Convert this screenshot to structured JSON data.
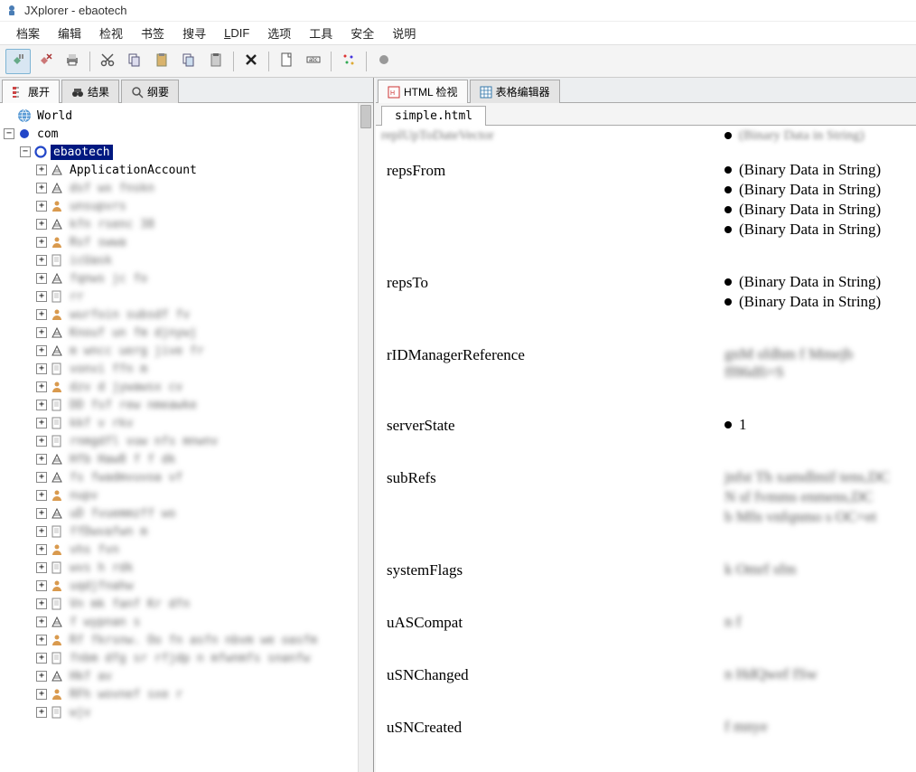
{
  "window": {
    "title": "JXplorer - ebaotech"
  },
  "menu": {
    "items": [
      {
        "label": "档案",
        "key": "file"
      },
      {
        "label": "编辑",
        "key": "edit"
      },
      {
        "label": "检视",
        "key": "view"
      },
      {
        "label": "书签",
        "key": "bookmark"
      },
      {
        "label": "搜寻",
        "key": "search"
      },
      {
        "label": "LDIF",
        "key": "ldif",
        "underlineFirst": true
      },
      {
        "label": "选项",
        "key": "options"
      },
      {
        "label": "工具",
        "key": "tools"
      },
      {
        "label": "安全",
        "key": "security"
      },
      {
        "label": "说明",
        "key": "help"
      }
    ]
  },
  "toolbar": {
    "groups": [
      [
        {
          "name": "connect",
          "icon": "plug"
        },
        {
          "name": "disconnect",
          "icon": "plug-x"
        },
        {
          "name": "print",
          "icon": "printer"
        }
      ],
      [
        {
          "name": "cut",
          "icon": "scissors"
        },
        {
          "name": "copy",
          "icon": "copy"
        },
        {
          "name": "paste",
          "icon": "paste"
        },
        {
          "name": "copy-alt",
          "icon": "copy2"
        },
        {
          "name": "paste-alt",
          "icon": "paste2"
        }
      ],
      [
        {
          "name": "delete",
          "icon": "x"
        }
      ],
      [
        {
          "name": "new",
          "icon": "page"
        },
        {
          "name": "rename",
          "icon": "field"
        }
      ],
      [
        {
          "name": "refresh",
          "icon": "sparkle"
        }
      ],
      [
        {
          "name": "stop",
          "icon": "stop-dot"
        }
      ]
    ]
  },
  "leftPane": {
    "tabs": [
      {
        "label": "展开",
        "icon": "tree",
        "active": true
      },
      {
        "label": "结果",
        "icon": "binoculars",
        "active": false
      },
      {
        "label": "纲要",
        "icon": "magnifier",
        "active": false
      }
    ],
    "tree": {
      "root": "World",
      "com": "com",
      "selected": "ebaotech",
      "children": [
        {
          "label": "ApplicationAccount",
          "clear": true
        },
        {
          "label": "dsf wx fnskn",
          "clear": false
        },
        {
          "label": "unsupvrs",
          "clear": false
        },
        {
          "label": "kfn rsenc 38",
          "clear": false
        },
        {
          "label": "Rsf swwa",
          "clear": false
        },
        {
          "label": "icUask",
          "clear": false
        },
        {
          "label": "fqnws jc fo",
          "clear": false
        },
        {
          "label": "rr",
          "clear": false
        },
        {
          "label": "wurfoin subsdf fv",
          "clear": false
        },
        {
          "label": "Knouf un fm djnywj",
          "clear": false
        },
        {
          "label": "m wncc uerg jive fr",
          "clear": false
        },
        {
          "label": "vonvi ffn m",
          "clear": false
        },
        {
          "label": "dzv d jywawsx cv",
          "clear": false
        },
        {
          "label": "DD fsf rew nmeawke",
          "clear": false
        },
        {
          "label": "kkf v rkv",
          "clear": false
        },
        {
          "label": "rnmgdfl vuw nfs mnwnv",
          "clear": false
        },
        {
          "label": "Hfb Haw8 f f dk",
          "clear": false
        },
        {
          "label": "fs fwadmvuvoa vf",
          "clear": false
        },
        {
          "label": "nupv",
          "clear": false
        },
        {
          "label": "uD fvuemmzff wo",
          "clear": false
        },
        {
          "label": "ffDwvafwn m",
          "clear": false
        },
        {
          "label": "vhs fvn",
          "clear": false
        },
        {
          "label": "wvs h rdk",
          "clear": false
        },
        {
          "label": "uqdjfnahw",
          "clear": false
        },
        {
          "label": "Vn mk fanf Kr dfn",
          "clear": false
        },
        {
          "label": "f wypnan s",
          "clear": false
        },
        {
          "label": "Rf fkrsnw. Oo fn asfn nbvm we oasfm",
          "clear": false
        },
        {
          "label": "fnbm dfg sr rfjdp n mfwnmfs snanfw",
          "clear": false
        },
        {
          "label": "Hkf av",
          "clear": false
        },
        {
          "label": "RFh wovnef sxe r",
          "clear": false
        },
        {
          "label": "wjv",
          "clear": false
        }
      ]
    }
  },
  "rightPane": {
    "tabs": [
      {
        "label": "HTML 检视",
        "icon": "html",
        "active": true
      },
      {
        "label": "表格编辑器",
        "icon": "table",
        "active": false
      }
    ],
    "subtab": "simple.html",
    "attributes": [
      {
        "name_partial": "replUpToDateVector",
        "cut": true,
        "values": [
          {
            "text": "(Binary Data in String)",
            "bullet": true,
            "blurred": false,
            "cut": true
          }
        ]
      },
      {
        "name": "repsFrom",
        "values": [
          {
            "text": "(Binary Data in String)",
            "bullet": true
          },
          {
            "text": "(Binary Data in String)",
            "bullet": true
          },
          {
            "text": "(Binary Data in String)",
            "bullet": true
          },
          {
            "text": "(Binary Data in String)",
            "bullet": true
          }
        ]
      },
      {
        "name": "repsTo",
        "values": [
          {
            "text": "(Binary Data in String)",
            "bullet": true
          },
          {
            "text": "(Binary Data in String)",
            "bullet": true
          }
        ]
      },
      {
        "name": "rIDManagerReference",
        "values": [
          {
            "text": "gnM  sfdhm f Mmejb ff86dfi=S",
            "bullet": false,
            "blurred": true
          }
        ]
      },
      {
        "name": "serverState",
        "values": [
          {
            "text": "1",
            "bullet": true
          }
        ]
      },
      {
        "name": "subRefs",
        "values": [
          {
            "text": "jnfst Th xamdlmif tens,DC",
            "bullet": false,
            "blurred": true
          },
          {
            "text": "N sf fvmms  enmens,DC",
            "bullet": false,
            "blurred": true
          },
          {
            "text": "b Mfn vnfqnmo s OC=et",
            "bullet": false,
            "blurred": true
          }
        ]
      },
      {
        "name": "systemFlags",
        "values": [
          {
            "text": "k Omrf sfm",
            "bullet": false,
            "blurred": true
          }
        ]
      },
      {
        "name": "uASCompat",
        "values": [
          {
            "text": "n f",
            "bullet": false,
            "blurred": true
          }
        ]
      },
      {
        "name": "uSNChanged",
        "values": [
          {
            "text": "n HdQwef fSw",
            "bullet": false,
            "blurred": true
          }
        ]
      },
      {
        "name": "uSNCreated",
        "values": [
          {
            "text": "f  mnye",
            "bullet": false,
            "blurred": true
          }
        ]
      }
    ]
  }
}
